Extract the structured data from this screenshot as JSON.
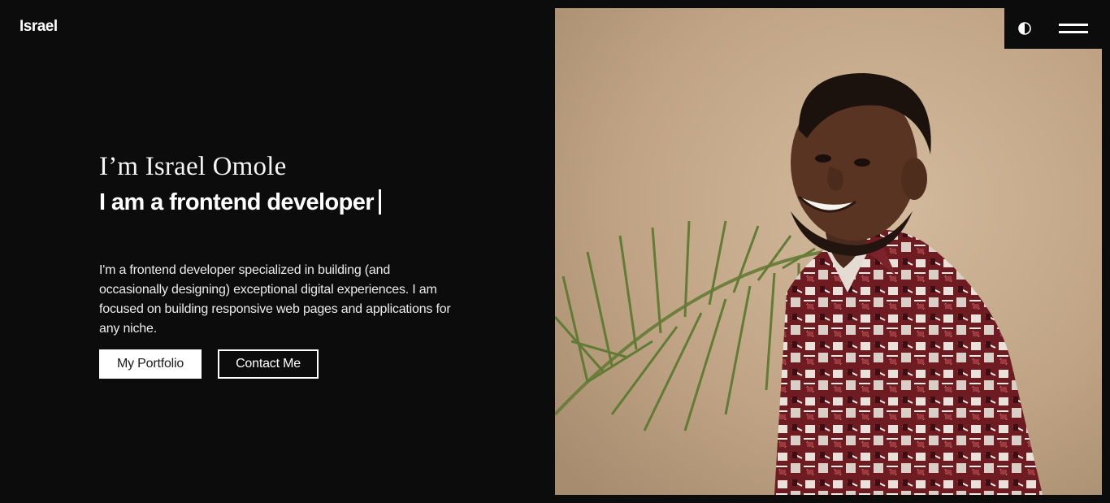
{
  "header": {
    "brand": "Israel",
    "theme_toggle_icon": "contrast-icon",
    "menu_icon": "hamburger-menu-icon"
  },
  "hero": {
    "greeting": "I’m Israel Omole",
    "role": "I am a frontend developer",
    "intro": "I'm a frontend developer specialized in building (and occasionally designing) exceptional digital experiences. I am focused on building responsive web pages and applications for any niche.",
    "buttons": {
      "portfolio": "My Portfolio",
      "contact": "Contact Me"
    }
  },
  "photo": {
    "subject": "portrait of smiling man in patterned shirt beside a palm frond",
    "colors": {
      "background": "#c2a78a",
      "shirt": "#7a1f24"
    }
  },
  "colors": {
    "page_background": "#0c0c0c",
    "text": "#ffffff"
  }
}
